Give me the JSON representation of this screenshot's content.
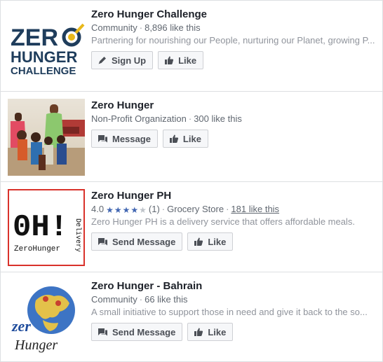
{
  "results": [
    {
      "title": "Zero Hunger Challenge",
      "category": "Community",
      "likes": "8,896 like this",
      "description": "Partnering for nourishing our People, nurturing our Planet, growing P...",
      "primary_button": "Sign Up",
      "like_button": "Like",
      "logo": {
        "line1": "ZER",
        "line2": "HUNGER",
        "line3": "CHALLENGE"
      }
    },
    {
      "title": "Zero Hunger",
      "category": "Non-Profit Organization",
      "likes": "300 like this",
      "primary_button": "Message",
      "like_button": "Like"
    },
    {
      "title": "Zero Hunger PH",
      "rating": "4.0",
      "rating_value": 4,
      "review_count": "(1)",
      "category": "Grocery Store",
      "likes": "181 like this",
      "description": "Zero Hunger PH is a delivery service that offers affordable meals.",
      "primary_button": "Send Message",
      "like_button": "Like",
      "logo": {
        "big": "0H!",
        "small": "ZeroHunger",
        "vertical": "Delivery"
      }
    },
    {
      "title": "Zero Hunger - Bahrain",
      "category": "Community",
      "likes": "66 like this",
      "description": "A small initiative to support those in need and give it back to the so...",
      "primary_button": "Send Message",
      "like_button": "Like",
      "logo": {
        "line1": "zer",
        "line2": "Hunger"
      }
    }
  ],
  "colors": {
    "title": "#1d2129",
    "meta": "#606770",
    "desc": "#90949c",
    "star_on": "#4267b2",
    "zhc_navy": "#1f3d5c",
    "zhc_gold": "#e8b81a",
    "ph_red": "#d9322b"
  }
}
